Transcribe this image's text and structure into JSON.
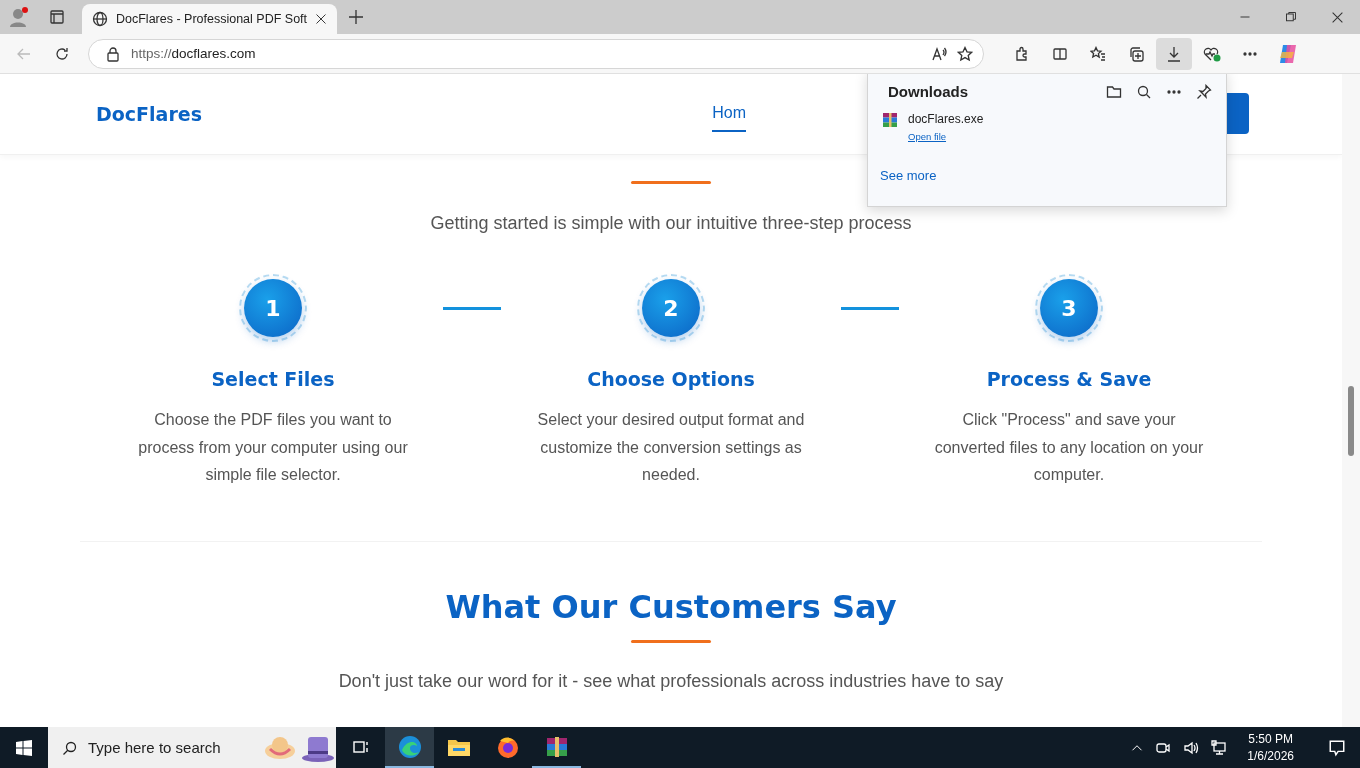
{
  "browser": {
    "tabs": [
      {
        "title": "DocFlares - Professional PDF Soft",
        "selected": true
      }
    ],
    "url_scheme": "https://",
    "url_host": "docflares.com"
  },
  "site": {
    "logo": "DocFlares",
    "nav": [
      {
        "label": "Hom",
        "selected": true
      }
    ],
    "how_it_works": {
      "subtitle": "Getting started is simple with our intuitive three-step process",
      "steps": [
        {
          "number": "1",
          "title": "Select Files",
          "text": "Choose the PDF files you want to process from your computer using our simple file selector."
        },
        {
          "number": "2",
          "title": "Choose Options",
          "text": "Select your desired output format and customize the conversion settings as needed."
        },
        {
          "number": "3",
          "title": "Process & Save",
          "text": "Click \"Process\" and save your converted files to any location on your computer."
        }
      ]
    },
    "testimonials": {
      "title": "What Our Customers Say",
      "subtitle": "Don't just take our word for it - see what professionals across industries have to say"
    }
  },
  "downloads": {
    "title": "Downloads",
    "items": [
      {
        "name": "docFlares.exe",
        "action": "Open file"
      }
    ],
    "see_more": "See more"
  },
  "taskbar": {
    "search_placeholder": "Type here to search",
    "apps": [
      {
        "kind": "taskview",
        "running": false,
        "selected": false
      },
      {
        "kind": "edge",
        "running": true,
        "selected": true
      },
      {
        "kind": "files",
        "running": false,
        "selected": false
      },
      {
        "kind": "firefox",
        "running": false,
        "selected": false
      },
      {
        "kind": "archive",
        "running": true,
        "selected": false
      }
    ],
    "time": "5:50 PM",
    "date": "1/6/2026"
  }
}
